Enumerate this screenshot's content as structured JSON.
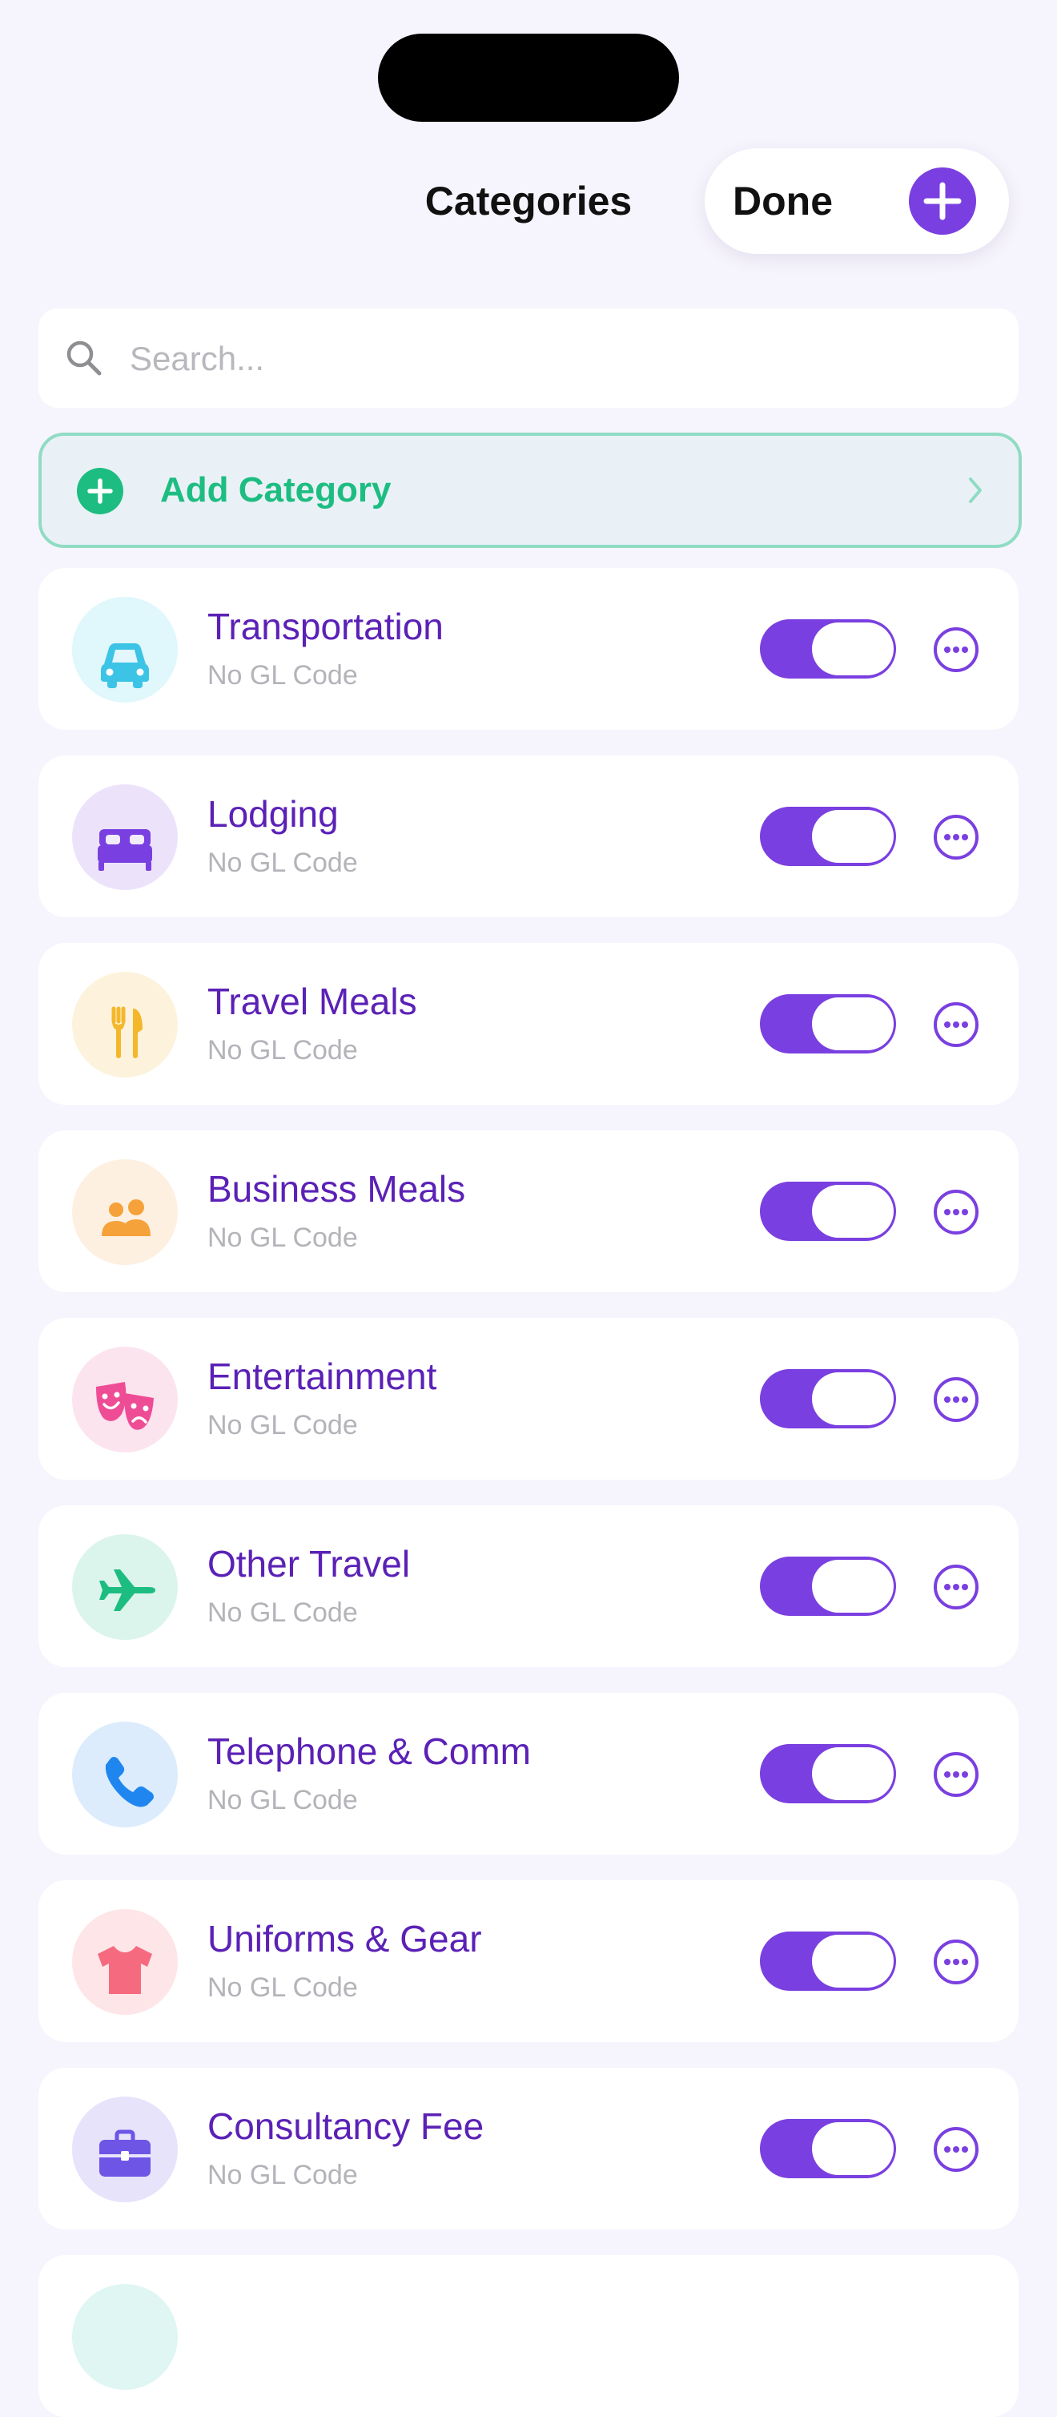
{
  "header": {
    "title": "Categories",
    "done_label": "Done",
    "add_icon": "plus-icon"
  },
  "search": {
    "placeholder": "Search...",
    "value": "",
    "icon": "search-icon"
  },
  "add_category": {
    "label": "Add Category",
    "icon": "plus-circle-icon",
    "chevron": "chevron-right-icon"
  },
  "colors": {
    "accent": "#7a3fe0",
    "name_text": "#5b21b6",
    "add_green": "#1dbd82"
  },
  "categories": [
    {
      "name": "Transportation",
      "gl": "No GL Code",
      "icon": "car-icon",
      "color": "#3cc4e6",
      "bg": "#e0f7fb",
      "enabled": true
    },
    {
      "name": "Lodging",
      "gl": "No GL Code",
      "icon": "bed-icon",
      "color": "#7a3fe0",
      "bg": "#ece3fb",
      "enabled": true
    },
    {
      "name": "Travel Meals",
      "gl": "No GL Code",
      "icon": "fork-knife-icon",
      "color": "#f5b72a",
      "bg": "#fdf3dd",
      "enabled": true
    },
    {
      "name": "Business Meals",
      "gl": "No GL Code",
      "icon": "people-icon",
      "color": "#f5a23a",
      "bg": "#fdf0e1",
      "enabled": true
    },
    {
      "name": "Entertainment",
      "gl": "No GL Code",
      "icon": "theater-masks-icon",
      "color": "#ee4d96",
      "bg": "#fce4ef",
      "enabled": true
    },
    {
      "name": "Other Travel",
      "gl": "No GL Code",
      "icon": "airplane-icon",
      "color": "#1dbd82",
      "bg": "#dcf5ec",
      "enabled": true
    },
    {
      "name": "Telephone & Comm",
      "gl": "No GL Code",
      "icon": "phone-icon",
      "color": "#1f86f0",
      "bg": "#dcecfc",
      "enabled": true
    },
    {
      "name": "Uniforms & Gear",
      "gl": "No GL Code",
      "icon": "tshirt-icon",
      "color": "#f66a80",
      "bg": "#fde5e8",
      "enabled": true
    },
    {
      "name": "Consultancy Fee",
      "gl": "No GL Code",
      "icon": "briefcase-icon",
      "color": "#6e55e6",
      "bg": "#e6e3fb",
      "enabled": true
    }
  ]
}
